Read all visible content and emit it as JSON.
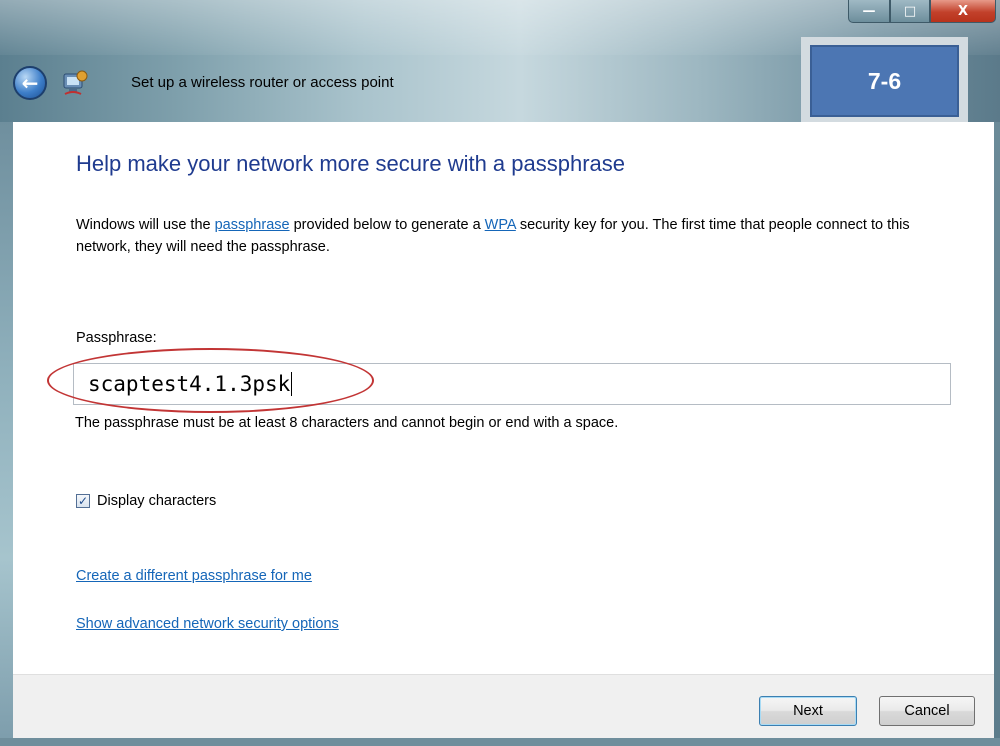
{
  "window": {
    "title": "Set up a wireless router or access point",
    "stamp": "7-6",
    "caption": {
      "minimize": "—",
      "maximize": "□",
      "close": "X"
    }
  },
  "content": {
    "heading": "Help make your network more secure with a passphrase",
    "desc_part1": "Windows will use the ",
    "desc_link1": "passphrase",
    "desc_part2": " provided below to generate a ",
    "desc_link2": "WPA",
    "desc_part3": " security key for you. The first time that people connect to this network, they will need the passphrase.",
    "passphrase_label": "Passphrase:",
    "passphrase_value": "scaptest4.1.3psk",
    "hint": "The passphrase must be at least 8 characters and cannot begin or end with a space.",
    "display_characters": {
      "label": "Display characters",
      "checked": true
    },
    "links": {
      "create_different": "Create a different passphrase for me",
      "show_advanced": "Show advanced network security options"
    }
  },
  "footer": {
    "next_label": "Next",
    "cancel_label": "Cancel"
  },
  "colors": {
    "heading": "#1f3b8f",
    "link": "#1566b8",
    "stamp_bg": "#4c76b3",
    "highlight_ellipse": "#c23535"
  },
  "icons": {
    "back": "back-arrow-icon",
    "wizard": "network-wizard-icon",
    "check": "checkmark-icon"
  }
}
